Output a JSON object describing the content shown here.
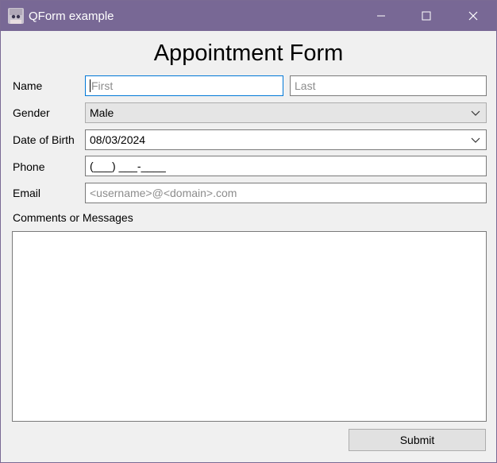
{
  "window": {
    "title": "QForm example",
    "titlebar_color": "#786895"
  },
  "form": {
    "heading": "Appointment Form",
    "name": {
      "label": "Name",
      "first_placeholder": "First",
      "last_placeholder": "Last"
    },
    "gender": {
      "label": "Gender",
      "selected": "Male"
    },
    "dob": {
      "label": "Date of Birth",
      "value": "08/03/2024"
    },
    "phone": {
      "label": "Phone",
      "mask": "(___) ___-____"
    },
    "email": {
      "label": "Email",
      "placeholder": "<username>@<domain>.com"
    },
    "comments": {
      "label": "Comments or Messages"
    },
    "submit_label": "Submit"
  },
  "icons": {
    "app": "app-avatar-icon",
    "minimize": "minimize-icon",
    "maximize": "maximize-icon",
    "close": "close-icon",
    "dropdown": "chevron-down-icon"
  },
  "colors": {
    "focus_border": "#0078d7",
    "background": "#f0f0f0"
  }
}
